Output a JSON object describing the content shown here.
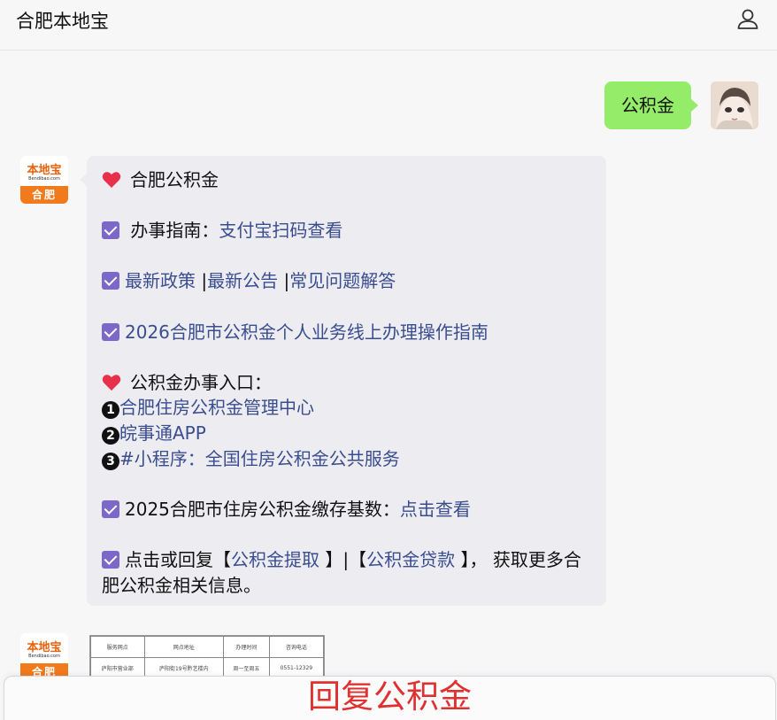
{
  "header": {
    "title": "合肥本地宝",
    "user_icon": "user-icon"
  },
  "user_message": {
    "text": "公积金"
  },
  "bot_avatar": {
    "brand": "本地宝",
    "domain": "Bendibao.com",
    "city": "合肥"
  },
  "bot_message": {
    "title": "合肥公积金",
    "guide_label": "办事指南：",
    "guide_link": "支付宝扫码查看",
    "policy_link": "最新政策",
    "sep1": " |",
    "notice_link": "最新公告",
    "sep2": " |",
    "faq_link": "常见问题解答",
    "guide2026_link": "2026合肥市公积金个人业务线上办理操作指南",
    "entry_title": "公积金办事入口：",
    "entries": [
      {
        "num": "1",
        "text": "合肥住房公积金管理中心"
      },
      {
        "num": "2",
        "text": "皖事通APP"
      },
      {
        "num": "3",
        "text": "#小程序：全国住房公积金公共服务"
      }
    ],
    "base_label": "2025合肥市住房公积金缴存基数：",
    "base_link": "点击查看",
    "reply_prefix": "点击或回复【",
    "reply_link1": "公积金提取 ",
    "reply_mid": "】|【",
    "reply_link2": "公积金贷款 ",
    "reply_suffix": "】， 获取更多合肥公积金相关信息。"
  },
  "table_preview": {
    "headers": [
      "服务网点",
      "网点地址",
      "办理时间",
      "咨询电话"
    ],
    "row": [
      "庐阳市营业部",
      "庐阳街19号黔艺楼内",
      "周一至周五",
      "0551-12329"
    ]
  },
  "footer": {
    "cta": "回复公积金"
  },
  "colors": {
    "link": "#3a4d8f",
    "user_bubble": "#95ec69",
    "bot_bubble": "#ececf1",
    "cta": "#e03131",
    "check": "#7b68c8"
  }
}
